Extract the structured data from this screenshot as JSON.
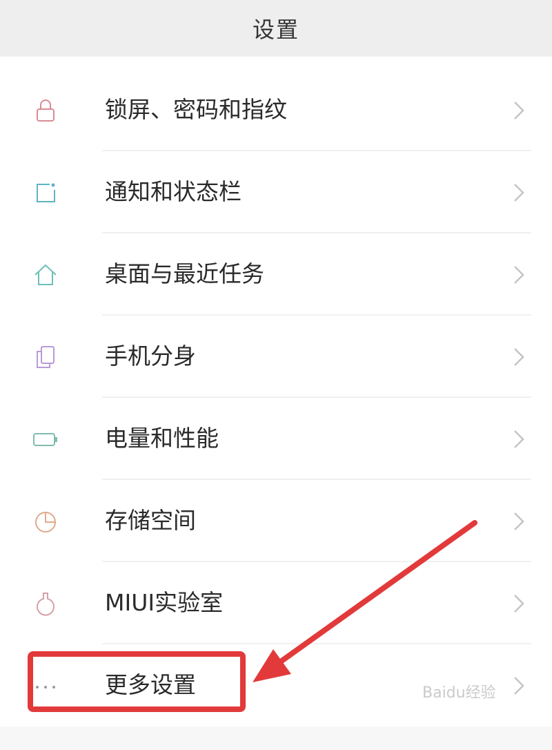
{
  "header": {
    "title": "设置"
  },
  "settings": {
    "items": [
      {
        "label": "锁屏、密码和指纹",
        "icon": "lock-icon",
        "color": "#d98a93"
      },
      {
        "label": "通知和状态栏",
        "icon": "notification-icon",
        "color": "#5fb3c4"
      },
      {
        "label": "桌面与最近任务",
        "icon": "home-icon",
        "color": "#6cc0b6"
      },
      {
        "label": "手机分身",
        "icon": "dual-phone-icon",
        "color": "#b89ad6"
      },
      {
        "label": "电量和性能",
        "icon": "battery-icon",
        "color": "#7fbcb0"
      },
      {
        "label": "存储空间",
        "icon": "storage-pie-icon",
        "color": "#e0a98a"
      },
      {
        "label": "MIUI实验室",
        "icon": "lab-flask-icon",
        "color": "#d6a0a8"
      },
      {
        "label": "更多设置",
        "icon": "more-dots-icon",
        "color": "#9a9a9a"
      }
    ]
  },
  "annotation": {
    "highlight_color": "#e23a3a"
  },
  "watermark": {
    "text": "Baidu经验"
  }
}
